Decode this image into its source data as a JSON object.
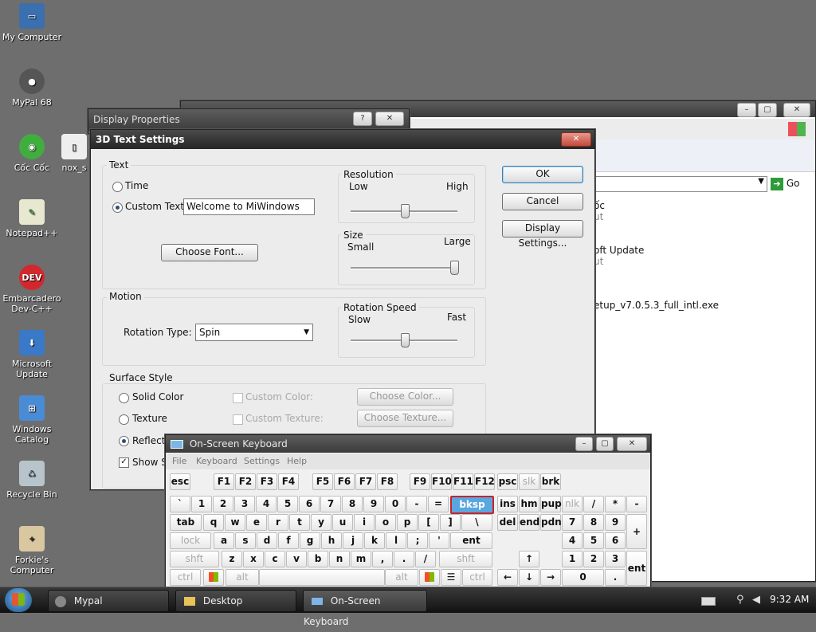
{
  "desktop_icons": [
    {
      "label": "My Computer"
    },
    {
      "label": "MyPal 68"
    },
    {
      "label": "Cốc Cốc"
    },
    {
      "label": "nox_s"
    },
    {
      "label": "Notepad++"
    },
    {
      "label": "Embarcadero Dev-C++"
    },
    {
      "label": "Microsoft Update"
    },
    {
      "label": "Windows Catalog"
    },
    {
      "label": "Recycle Bin"
    },
    {
      "label": "Forkie's Computer"
    }
  ],
  "explorer": {
    "go_label": "Go",
    "items": [
      "ốc",
      "ut",
      "oft Update",
      "ut",
      "etup_v7.0.5.3_full_intl.exe"
    ]
  },
  "display_properties": {
    "title": "Display Properties",
    "help": "?",
    "close": "✕"
  },
  "dialog": {
    "title": "3D Text Settings",
    "close": "✕",
    "text_group": "Text",
    "time_label": "Time",
    "custom_text_label": "Custom Text:",
    "custom_text_value": "Welcome to MiWindows",
    "choose_font": "Choose Font...",
    "resolution_group": "Resolution",
    "res_low": "Low",
    "res_high": "High",
    "resolution_level": 0.5,
    "size_group": "Size",
    "size_small": "Small",
    "size_large": "Large",
    "size_level": 1.0,
    "motion_group": "Motion",
    "rotation_type_label": "Rotation Type:",
    "rotation_type_value": "Spin",
    "rotation_speed_group": "Rotation Speed",
    "speed_slow": "Slow",
    "speed_fast": "Fast",
    "speed_level": 0.5,
    "surface_group": "Surface Style",
    "solid_color": "Solid Color",
    "texture": "Texture",
    "reflection": "Reflectio",
    "show_specular": "Show Sp",
    "custom_color": "Custom Color:",
    "custom_texture": "Custom Texture:",
    "choose_color": "Choose Color...",
    "choose_texture": "Choose Texture...",
    "ok": "OK",
    "cancel": "Cancel",
    "display_settings": "Display Settings..."
  },
  "osk": {
    "title": "On-Screen Keyboard",
    "menu": [
      "File",
      "Keyboard",
      "Settings",
      "Help"
    ],
    "row1": [
      "esc",
      "F1",
      "F2",
      "F3",
      "F4",
      "F5",
      "F6",
      "F7",
      "F8",
      "F9",
      "F10",
      "F11",
      "F12",
      "psc",
      "slk",
      "brk"
    ],
    "row2": [
      "`",
      "1",
      "2",
      "3",
      "4",
      "5",
      "6",
      "7",
      "8",
      "9",
      "0",
      "-",
      "=",
      "bksp",
      "ins",
      "hm",
      "pup",
      "nlk",
      "/",
      "*",
      "-"
    ],
    "row3": [
      "tab",
      "q",
      "w",
      "e",
      "r",
      "t",
      "y",
      "u",
      "i",
      "o",
      "p",
      "[",
      "]",
      "\\",
      "del",
      "end",
      "pdn",
      "7",
      "8",
      "9",
      "+"
    ],
    "row4": [
      "lock",
      "a",
      "s",
      "d",
      "f",
      "g",
      "h",
      "j",
      "k",
      "l",
      ";",
      "'",
      "ent",
      "4",
      "5",
      "6"
    ],
    "row5": [
      "shft",
      "z",
      "x",
      "c",
      "v",
      "b",
      "n",
      "m",
      ",",
      ".",
      "/",
      "shft",
      "↑",
      "1",
      "2",
      "3",
      "ent"
    ],
    "row6": [
      "ctrl",
      "",
      "alt",
      "",
      "alt",
      "",
      "",
      "ctrl",
      "←",
      "↓",
      "→",
      "0",
      "."
    ]
  },
  "taskbar": {
    "items": [
      "Mypal",
      "Desktop",
      "On-Screen Keyboard"
    ],
    "clock": "9:32 AM"
  },
  "colors": {
    "desktop": "#6e6e6e",
    "highlight_key": "#5aa7df",
    "highlight_border": "#c8232c"
  }
}
